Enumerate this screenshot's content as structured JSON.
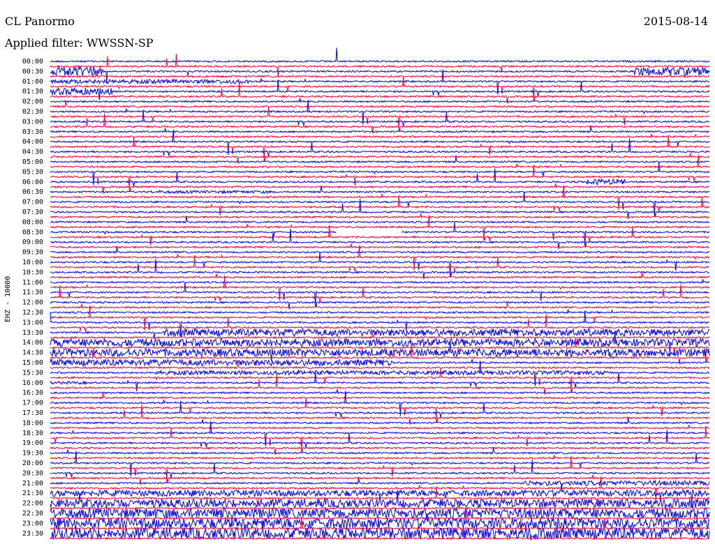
{
  "header": {
    "station": "CL Panormo",
    "date": "2015-08-14",
    "filter_label": "Applied filter: WWSSN-SP"
  },
  "chart_data": {
    "type": "line",
    "chart_kind": "helicorder",
    "ylabel": "EHZ - 10000",
    "colors": [
      "#0000ff",
      "#ff0033"
    ],
    "x_range_minutes": [
      0,
      15
    ],
    "tick_labels": [
      "00:00",
      "00:30",
      "01:00",
      "01:30",
      "02:00",
      "02:30",
      "03:00",
      "03:30",
      "04:00",
      "04:30",
      "05:00",
      "05:30",
      "06:00",
      "06:30",
      "07:00",
      "07:30",
      "08:00",
      "08:30",
      "09:00",
      "09:30",
      "10:00",
      "10:30",
      "11:00",
      "11:30",
      "12:00",
      "12:30",
      "13:00",
      "13:30",
      "14:00",
      "14:30",
      "15:00",
      "15:30",
      "16:00",
      "16:30",
      "17:00",
      "17:30",
      "18:00",
      "18:30",
      "19:00",
      "19:30",
      "20:00",
      "20:30",
      "21:00",
      "21:30",
      "22:00",
      "22:30",
      "23:00",
      "23:30"
    ],
    "lines_per_half_hour": 2,
    "gap": {
      "line_start": "08:30",
      "from_minute": 6.5,
      "to_minute": 8.0
    },
    "bursts": [
      {
        "line_start": "00:30",
        "from_minute": 0.0,
        "to_minute": 1.2,
        "amplitude": 14
      },
      {
        "line_start": "01:00",
        "from_minute": 0.0,
        "to_minute": 4.5,
        "amplitude": 6
      },
      {
        "line_start": "01:30",
        "from_minute": 0.0,
        "to_minute": 1.4,
        "amplitude": 10
      },
      {
        "line_start": "00:30",
        "from_minute": 13.3,
        "to_minute": 15.0,
        "amplitude": 12
      },
      {
        "line_start": "06:30",
        "from_minute": 2.3,
        "to_minute": 5.0,
        "amplitude": 4
      },
      {
        "line_start": "06:00",
        "from_minute": 12.2,
        "to_minute": 13.1,
        "amplitude": 8
      },
      {
        "line_start": "13:30",
        "from_minute": 2.6,
        "to_minute": 15.0,
        "amplitude": 10
      },
      {
        "line_start": "14:00",
        "from_minute": 0.0,
        "to_minute": 15.0,
        "amplitude": 11
      },
      {
        "line_start": "14:30",
        "from_minute": 0.0,
        "to_minute": 15.0,
        "amplitude": 11
      },
      {
        "line_start": "15:00",
        "from_minute": 0.0,
        "to_minute": 7.8,
        "amplitude": 9
      },
      {
        "line_start": "15:30",
        "from_minute": 2.4,
        "to_minute": 12.8,
        "amplitude": 6
      },
      {
        "line_start": "16:00",
        "from_minute": 0.0,
        "to_minute": 0.8,
        "amplitude": 4
      },
      {
        "line_start": "21:00",
        "from_minute": 10.8,
        "to_minute": 15.0,
        "amplitude": 7
      },
      {
        "line_start": "21:30",
        "from_minute": 0.0,
        "to_minute": 15.0,
        "amplitude": 9
      },
      {
        "line_start": "22:00",
        "from_minute": 0.0,
        "to_minute": 15.0,
        "amplitude": 12
      },
      {
        "line_start": "22:30",
        "from_minute": 0.0,
        "to_minute": 15.0,
        "amplitude": 14
      },
      {
        "line_start": "23:00",
        "from_minute": 0.0,
        "to_minute": 15.0,
        "amplitude": 15
      },
      {
        "line_start": "23:30",
        "from_minute": 0.0,
        "to_minute": 15.0,
        "amplitude": 16
      }
    ]
  }
}
